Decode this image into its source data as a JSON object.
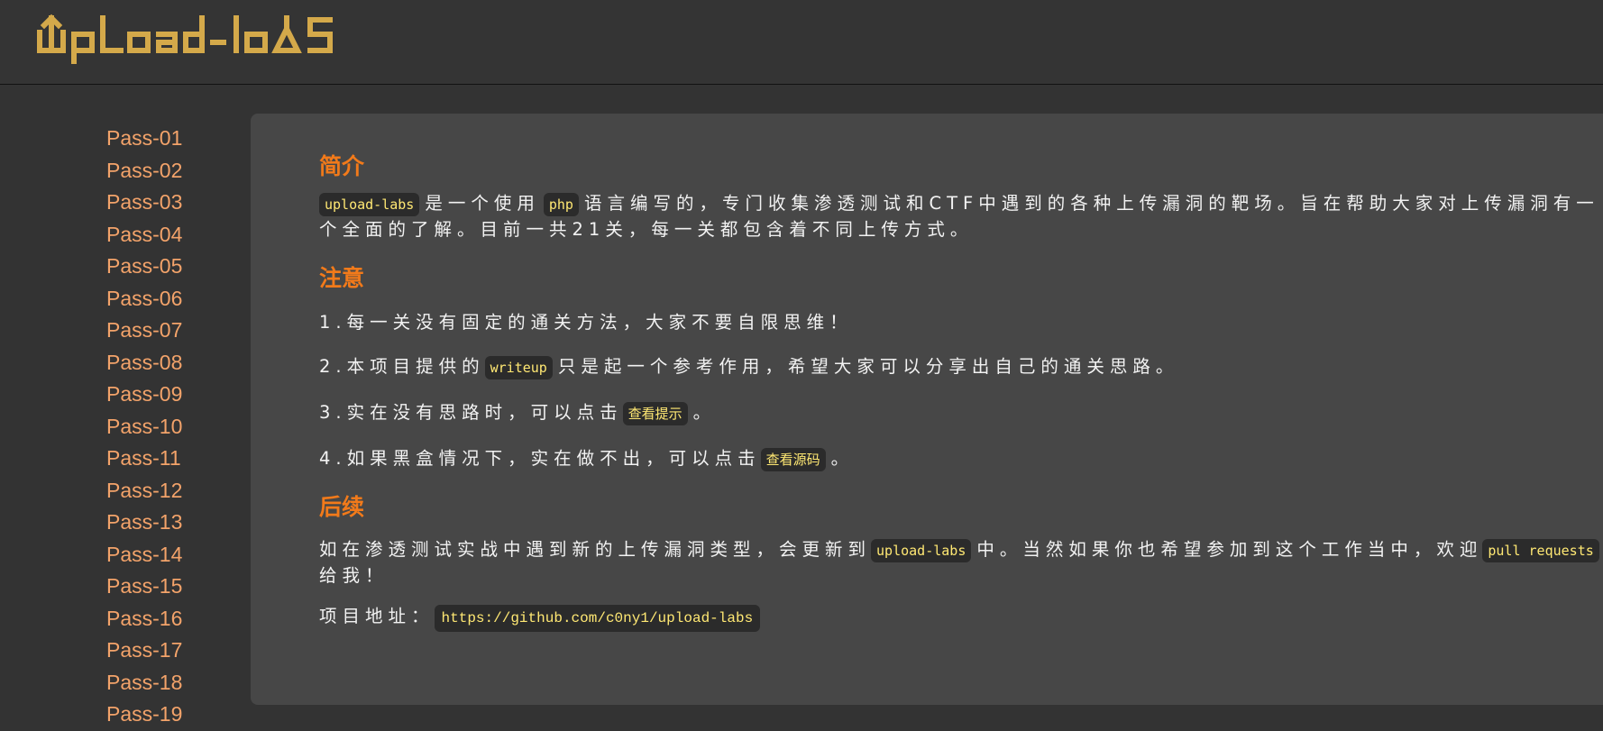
{
  "brand": {
    "logo_text": "Upload-labs",
    "accent": "#d4a94a"
  },
  "sidebar": {
    "items": [
      "Pass-01",
      "Pass-02",
      "Pass-03",
      "Pass-04",
      "Pass-05",
      "Pass-06",
      "Pass-07",
      "Pass-08",
      "Pass-09",
      "Pass-10",
      "Pass-11",
      "Pass-12",
      "Pass-13",
      "Pass-14",
      "Pass-15",
      "Pass-16",
      "Pass-17",
      "Pass-18",
      "Pass-19"
    ]
  },
  "intro": {
    "title": "简介",
    "code1": "upload-labs",
    "t1": "是一个使用",
    "code2": "php",
    "t2": "语言编写的，专门收集渗透测试和CTF中遇到的各种上传漏洞的靶场。旨在帮助大家对上传漏洞有一个全面的了解。目前一共21关，每一关都包含着不同上传方式。"
  },
  "notice": {
    "title": "注意",
    "n1": "1.每一关没有固定的通关方法，大家不要自限思维！",
    "n2a": "2.本项目提供的",
    "n2code": "writeup",
    "n2b": "只是起一个参考作用，希望大家可以分享出自己的通关思路。",
    "n3a": "3.实在没有思路时，可以点击",
    "n3btn": "查看提示",
    "n3b": "。",
    "n4a": "4.如果黑盒情况下，实在做不出，可以点击",
    "n4btn": "查看源码",
    "n4b": "。"
  },
  "followup": {
    "title": "后续",
    "t1": "如在渗透测试实战中遇到新的上传漏洞类型，会更新到",
    "code1": "upload-labs",
    "t2": "中。当然如果你也希望参加到这个工作当中，欢迎",
    "code2": "pull requests",
    "t3": "给我！",
    "addr_label": "项目地址：",
    "addr_url": "https://github.com/c0ny1/upload-labs"
  }
}
